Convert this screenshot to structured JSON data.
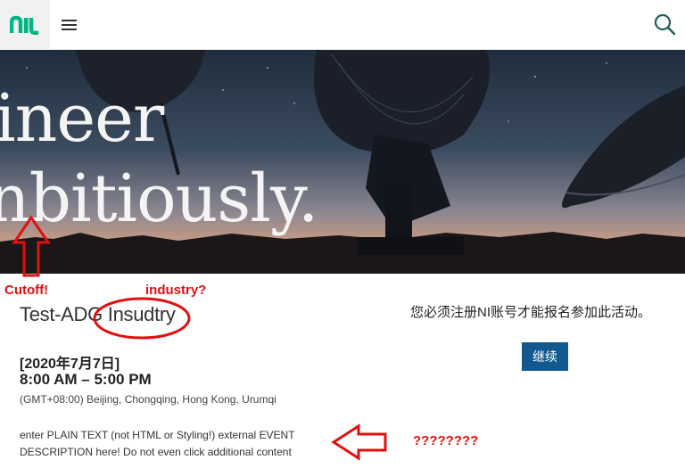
{
  "header": {
    "logo_text": "ni",
    "brand_color": "#03b585",
    "menu_icon": "hamburger-menu-icon",
    "search_icon": "search-icon"
  },
  "hero": {
    "line1": "ineer",
    "line2": "nbitiously."
  },
  "annotations": {
    "cutoff": "Cutoff!",
    "industry": "industry?",
    "questions": "????????",
    "color": "#e01010"
  },
  "event": {
    "title": "Test-ADG Insudtry",
    "date": "[2020年7月7日]",
    "time": "8:00 AM – 5:00 PM",
    "timezone": "(GMT+08:00) Beijing, Chongqing, Hong Kong, Urumqi",
    "description": "enter PLAIN TEXT (not HTML or Styling!) external EVENT DESCRIPTION here! Do not even click additional content"
  },
  "registration": {
    "note": "您必须注册NI账号才能报名参加此活动。",
    "continue_label": "继续",
    "button_color": "#11598f"
  }
}
